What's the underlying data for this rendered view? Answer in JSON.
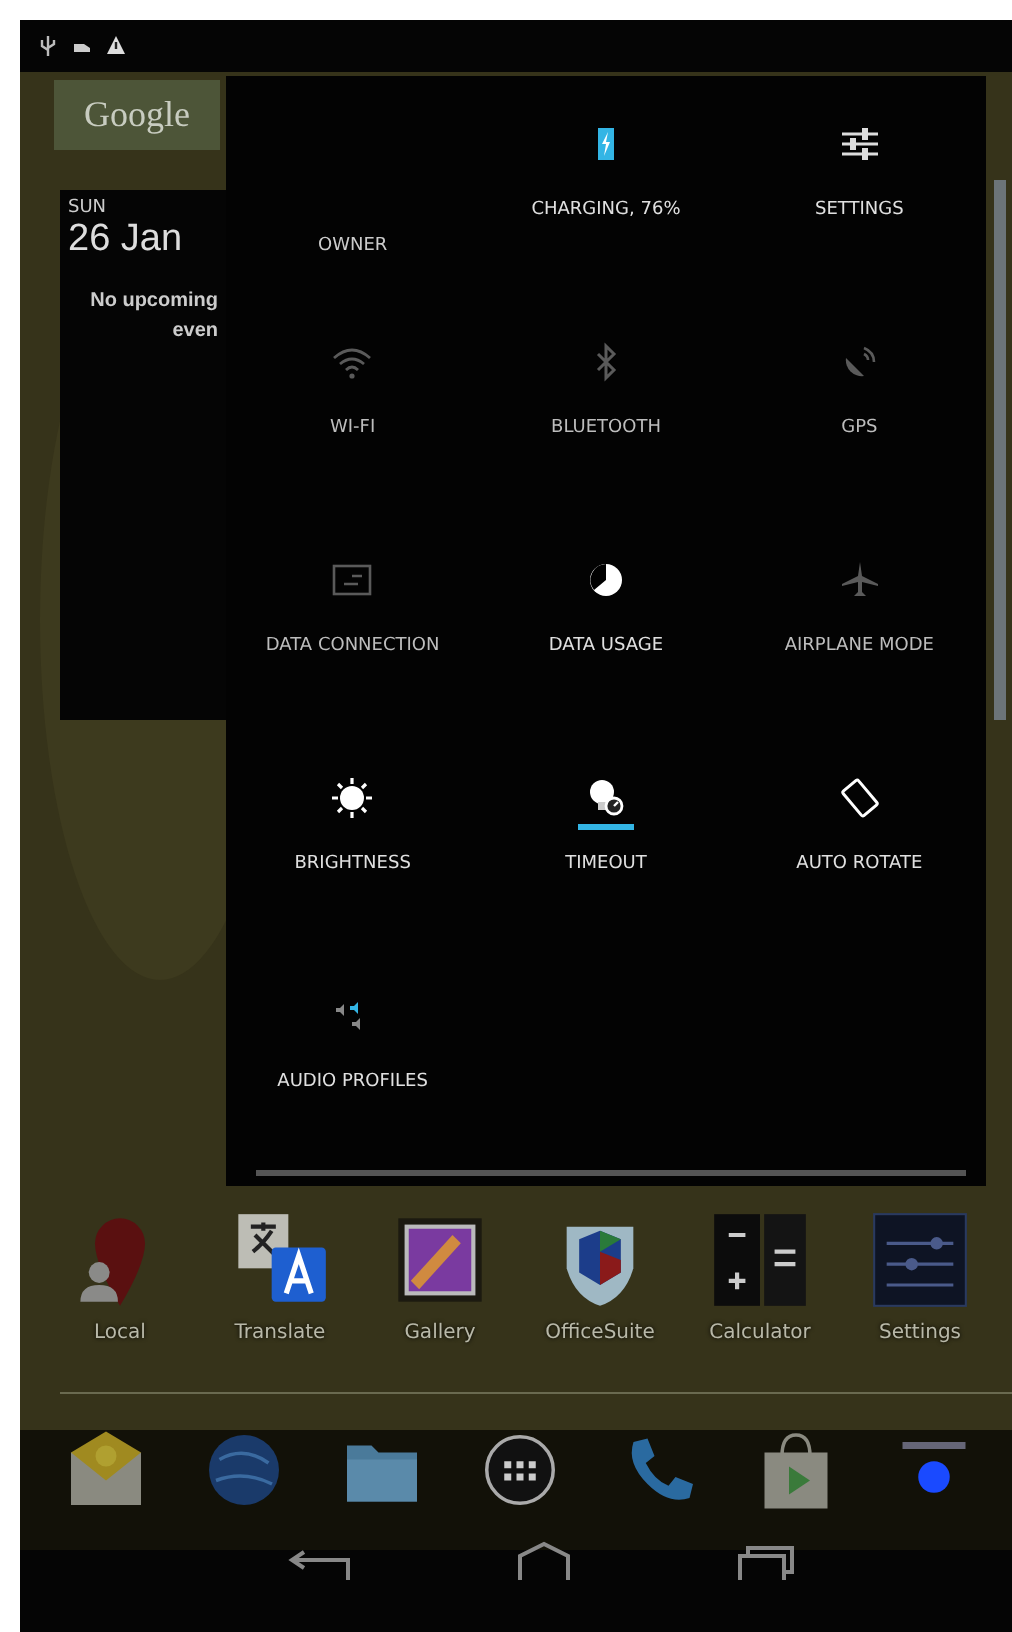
{
  "search_widget": {
    "label": "Google"
  },
  "calendar_widget": {
    "day": "SUN",
    "date": "26 Jan",
    "message": "No upcoming even"
  },
  "quick_settings": {
    "owner": "OWNER",
    "tiles": [
      {
        "kind": "battery",
        "label": "CHARGING, 76%",
        "on": true,
        "focused": false
      },
      {
        "kind": "settings",
        "label": "SETTINGS",
        "on": true,
        "focused": false
      },
      {
        "kind": "wifi",
        "label": "WI-FI",
        "on": false,
        "focused": false
      },
      {
        "kind": "bluetooth",
        "label": "BLUETOOTH",
        "on": false,
        "focused": false
      },
      {
        "kind": "gps",
        "label": "GPS",
        "on": false,
        "focused": false
      },
      {
        "kind": "data-connection",
        "label": "DATA CONNECTION",
        "on": false,
        "focused": false
      },
      {
        "kind": "data-usage",
        "label": "DATA USAGE",
        "on": true,
        "focused": false
      },
      {
        "kind": "airplane",
        "label": "AIRPLANE MODE",
        "on": false,
        "focused": false
      },
      {
        "kind": "brightness",
        "label": "BRIGHTNESS",
        "on": true,
        "focused": false
      },
      {
        "kind": "timeout",
        "label": "TIMEOUT",
        "on": true,
        "focused": true
      },
      {
        "kind": "rotate",
        "label": "AUTO ROTATE",
        "on": true,
        "focused": false
      },
      {
        "kind": "audio",
        "label": "AUDIO PROFILES",
        "on": true,
        "focused": false
      }
    ]
  },
  "apps": [
    {
      "kind": "local",
      "label": "Local"
    },
    {
      "kind": "translate",
      "label": "Translate"
    },
    {
      "kind": "gallery",
      "label": "Gallery"
    },
    {
      "kind": "office",
      "label": "OfficeSuite"
    },
    {
      "kind": "calculator",
      "label": "Calculator"
    },
    {
      "kind": "settings",
      "label": "Settings"
    }
  ]
}
